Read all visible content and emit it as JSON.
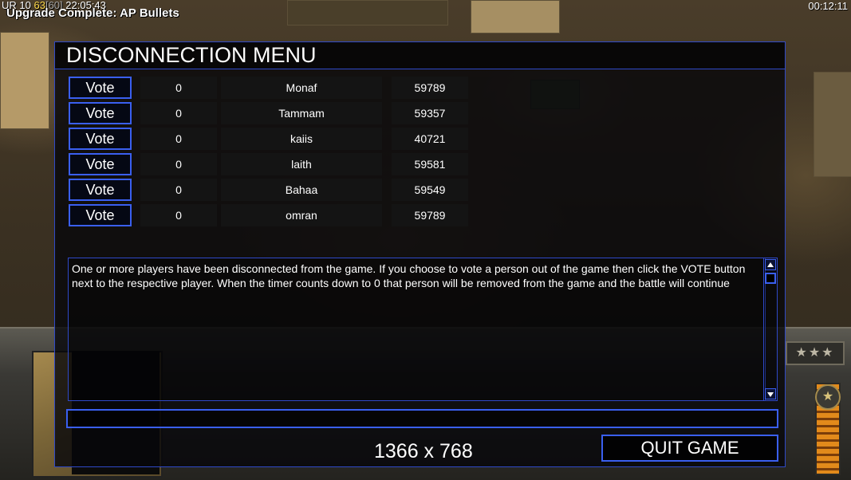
{
  "hud": {
    "stats_white": "UR 10",
    "stats_yellow": "63",
    "stats_gray": "[60]",
    "game_time": "22:05:43",
    "message": "Upgrade Complete: AP Bullets",
    "clock": "00:12:11"
  },
  "menu": {
    "title": "DISCONNECTION MENU",
    "vote_label": "Vote",
    "players": [
      {
        "votes": "0",
        "name": "Monaf",
        "ping": "59789"
      },
      {
        "votes": "0",
        "name": "Tammam",
        "ping": "59357"
      },
      {
        "votes": "0",
        "name": "kaiis",
        "ping": "40721"
      },
      {
        "votes": "0",
        "name": "laith",
        "ping": "59581"
      },
      {
        "votes": "0",
        "name": "Bahaa",
        "ping": "59549"
      },
      {
        "votes": "0",
        "name": "omran",
        "ping": "59789"
      }
    ],
    "message": "One or more players have been disconnected from the game. If you choose to vote a person out of the game then click the VOTE button next to the respective player. When the timer counts down to 0 that person will be removed from the game and the battle will continue",
    "chat_value": "",
    "resolution": "1366 x 768",
    "quit_label": "QUIT GAME"
  },
  "colors": {
    "border_blue": "#3a5ff0",
    "panel_bg": "#050810",
    "hud_yellow": "#ffd94a"
  },
  "icons": {
    "scroll_up": "triangle-up-icon",
    "scroll_down": "triangle-down-icon"
  }
}
